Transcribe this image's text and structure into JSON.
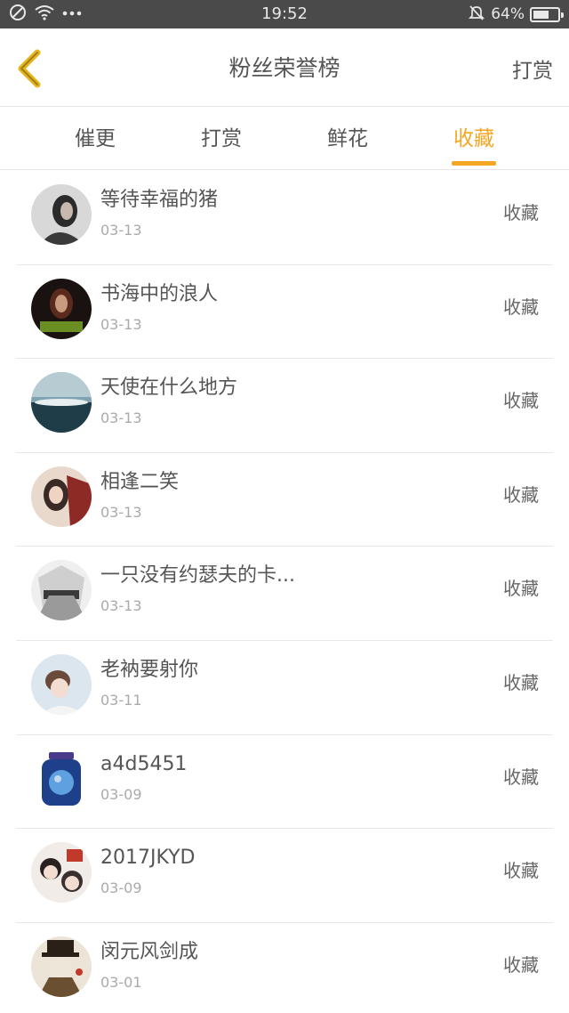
{
  "status_bar": {
    "time": "19:52",
    "battery_text": "64%",
    "battery_level": 0.64,
    "icons": [
      "no-sim-icon",
      "wifi-icon",
      "more-dots-icon",
      "mute-bell-icon",
      "battery-icon"
    ]
  },
  "header": {
    "title": "粉丝荣誉榜",
    "action": "打赏",
    "back_icon": "chevron-left-icon"
  },
  "tabs": [
    {
      "label": "催更",
      "active": false
    },
    {
      "label": "打赏",
      "active": false
    },
    {
      "label": "鲜花",
      "active": false
    },
    {
      "label": "收藏",
      "active": true
    }
  ],
  "colors": {
    "accent": "#f5a623",
    "status_bar_bg": "#4a4a4a",
    "text": "#555555",
    "subtext": "#aaaaaa",
    "divider": "#e8e8e8"
  },
  "fans": [
    {
      "name": "等待幸福的猪",
      "date": "03-13",
      "type": "收藏"
    },
    {
      "name": "书海中的浪人",
      "date": "03-13",
      "type": "收藏"
    },
    {
      "name": "天使在什么地方",
      "date": "03-13",
      "type": "收藏"
    },
    {
      "name": "相逢二笑",
      "date": "03-13",
      "type": "收藏"
    },
    {
      "name": "一只没有约瑟夫的卡...",
      "date": "03-13",
      "type": "收藏"
    },
    {
      "name": "老衲要射你",
      "date": "03-11",
      "type": "收藏"
    },
    {
      "name": "a4d5451",
      "date": "03-09",
      "type": "收藏"
    },
    {
      "name": "2017JKYD",
      "date": "03-09",
      "type": "收藏"
    },
    {
      "name": "闵元风剑成",
      "date": "03-01",
      "type": "收藏"
    }
  ]
}
